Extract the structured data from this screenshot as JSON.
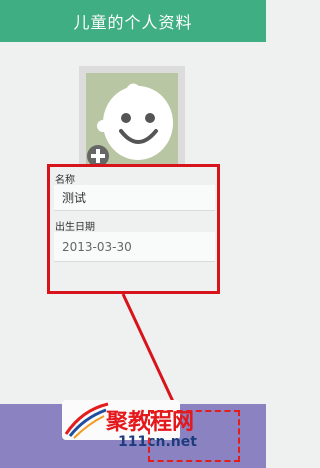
{
  "header": {
    "title": "儿童的个人资料"
  },
  "avatar": {
    "icon": "baby-face-icon",
    "add_icon": "plus-icon"
  },
  "form": {
    "name_label": "名称",
    "name_value": "测试",
    "date_label": "出生日期",
    "date_value": "2013-03-30"
  },
  "watermark": {
    "brand": "聚教程网",
    "url": "111cn.net"
  },
  "colors": {
    "header": "#3fae82",
    "highlight": "#d7141b",
    "bottom_bar": "#8b83c1"
  }
}
